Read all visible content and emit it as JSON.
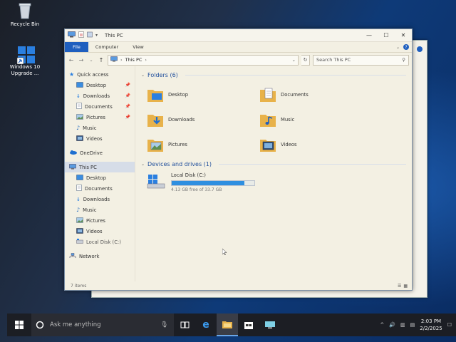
{
  "desktop": {
    "icons": [
      {
        "label": "Recycle Bin"
      },
      {
        "label_line1": "Windows 10",
        "label_line2": "Upgrade ..."
      }
    ]
  },
  "window": {
    "title": "This PC",
    "ribbon_tabs": [
      "File",
      "Computer",
      "View"
    ],
    "address": {
      "path_root": "This PC",
      "search_placeholder": "Search This PC"
    },
    "nav": {
      "quick_access": "Quick access",
      "quick_items": [
        "Desktop",
        "Downloads",
        "Documents",
        "Pictures",
        "Music",
        "Videos"
      ],
      "onedrive": "OneDrive",
      "this_pc": "This PC",
      "pc_items": [
        "Desktop",
        "Documents",
        "Downloads",
        "Music",
        "Pictures",
        "Videos",
        "Local Disk (C:)"
      ],
      "network": "Network"
    },
    "folders_header": "Folders (6)",
    "folders": [
      "Desktop",
      "Documents",
      "Downloads",
      "Music",
      "Pictures",
      "Videos"
    ],
    "devices_header": "Devices and drives (1)",
    "drive": {
      "label": "Local Disk (C:)",
      "free_text": "4.13 GB free of 33.7 GB",
      "used_fraction": 0.88
    },
    "status": "7 items"
  },
  "taskbar": {
    "search_text": "Ask me anything",
    "time": "2:03 PM",
    "date": "2/2/2025"
  },
  "colors": {
    "accent": "#1f5fbf",
    "taskbar": "#1c1e24",
    "folder": "#e8b24a"
  }
}
